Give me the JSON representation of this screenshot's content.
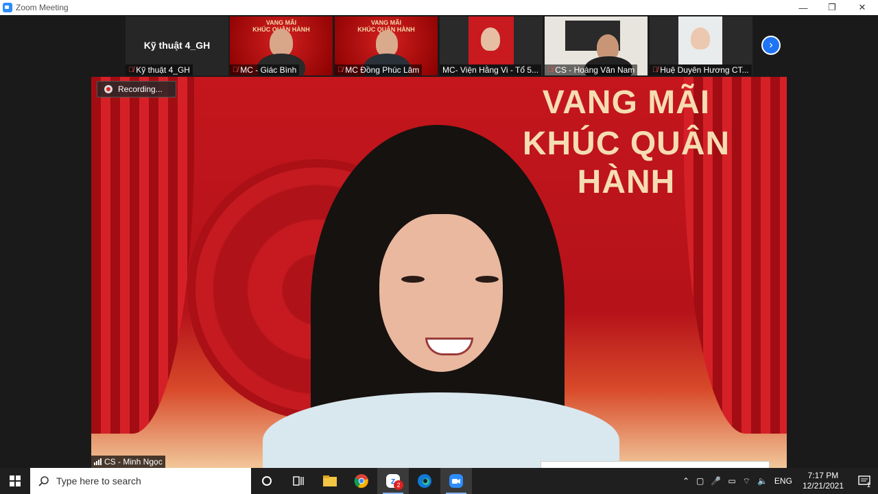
{
  "window": {
    "title": "Zoom Meeting",
    "minimize": "—",
    "maximize": "❐",
    "close": "✕"
  },
  "thumbnails": [
    {
      "name": "Kỹ thuật 4_GH",
      "big_name": "Kỹ thuật 4_GH",
      "muted": true
    },
    {
      "name": "MC - Giác Bình",
      "muted": true,
      "banner": "VANG MÃI\nKHÚC QUÂN HÀNH"
    },
    {
      "name": "MC Đồng Phúc Lâm",
      "muted": true,
      "banner": "VANG MÃI\nKHÚC QUÂN HÀNH"
    },
    {
      "name": "MC- Viện Hằng Vi - Tổ 5...",
      "muted": false
    },
    {
      "name": "CS - Hoàng Văn Nam",
      "muted": true
    },
    {
      "name": "Huệ Duyên Hương CT...",
      "muted": true
    }
  ],
  "main": {
    "speaker_name": "CS - Minh Ngọc",
    "recording_label": "Recording...",
    "background_title_line1": "VANG MÃI",
    "background_title_line2": "KHÚC QUÂN HÀNH"
  },
  "taskbar": {
    "search_placeholder": "Type here to search",
    "zalo_badge": "2",
    "language": "ENG",
    "time": "7:17 PM",
    "date": "12/21/2021",
    "notification_count": "1"
  },
  "colors": {
    "zoom_blue": "#2d8cff",
    "mute_red": "#ff4d4d",
    "banner_red": "#c4161c"
  }
}
